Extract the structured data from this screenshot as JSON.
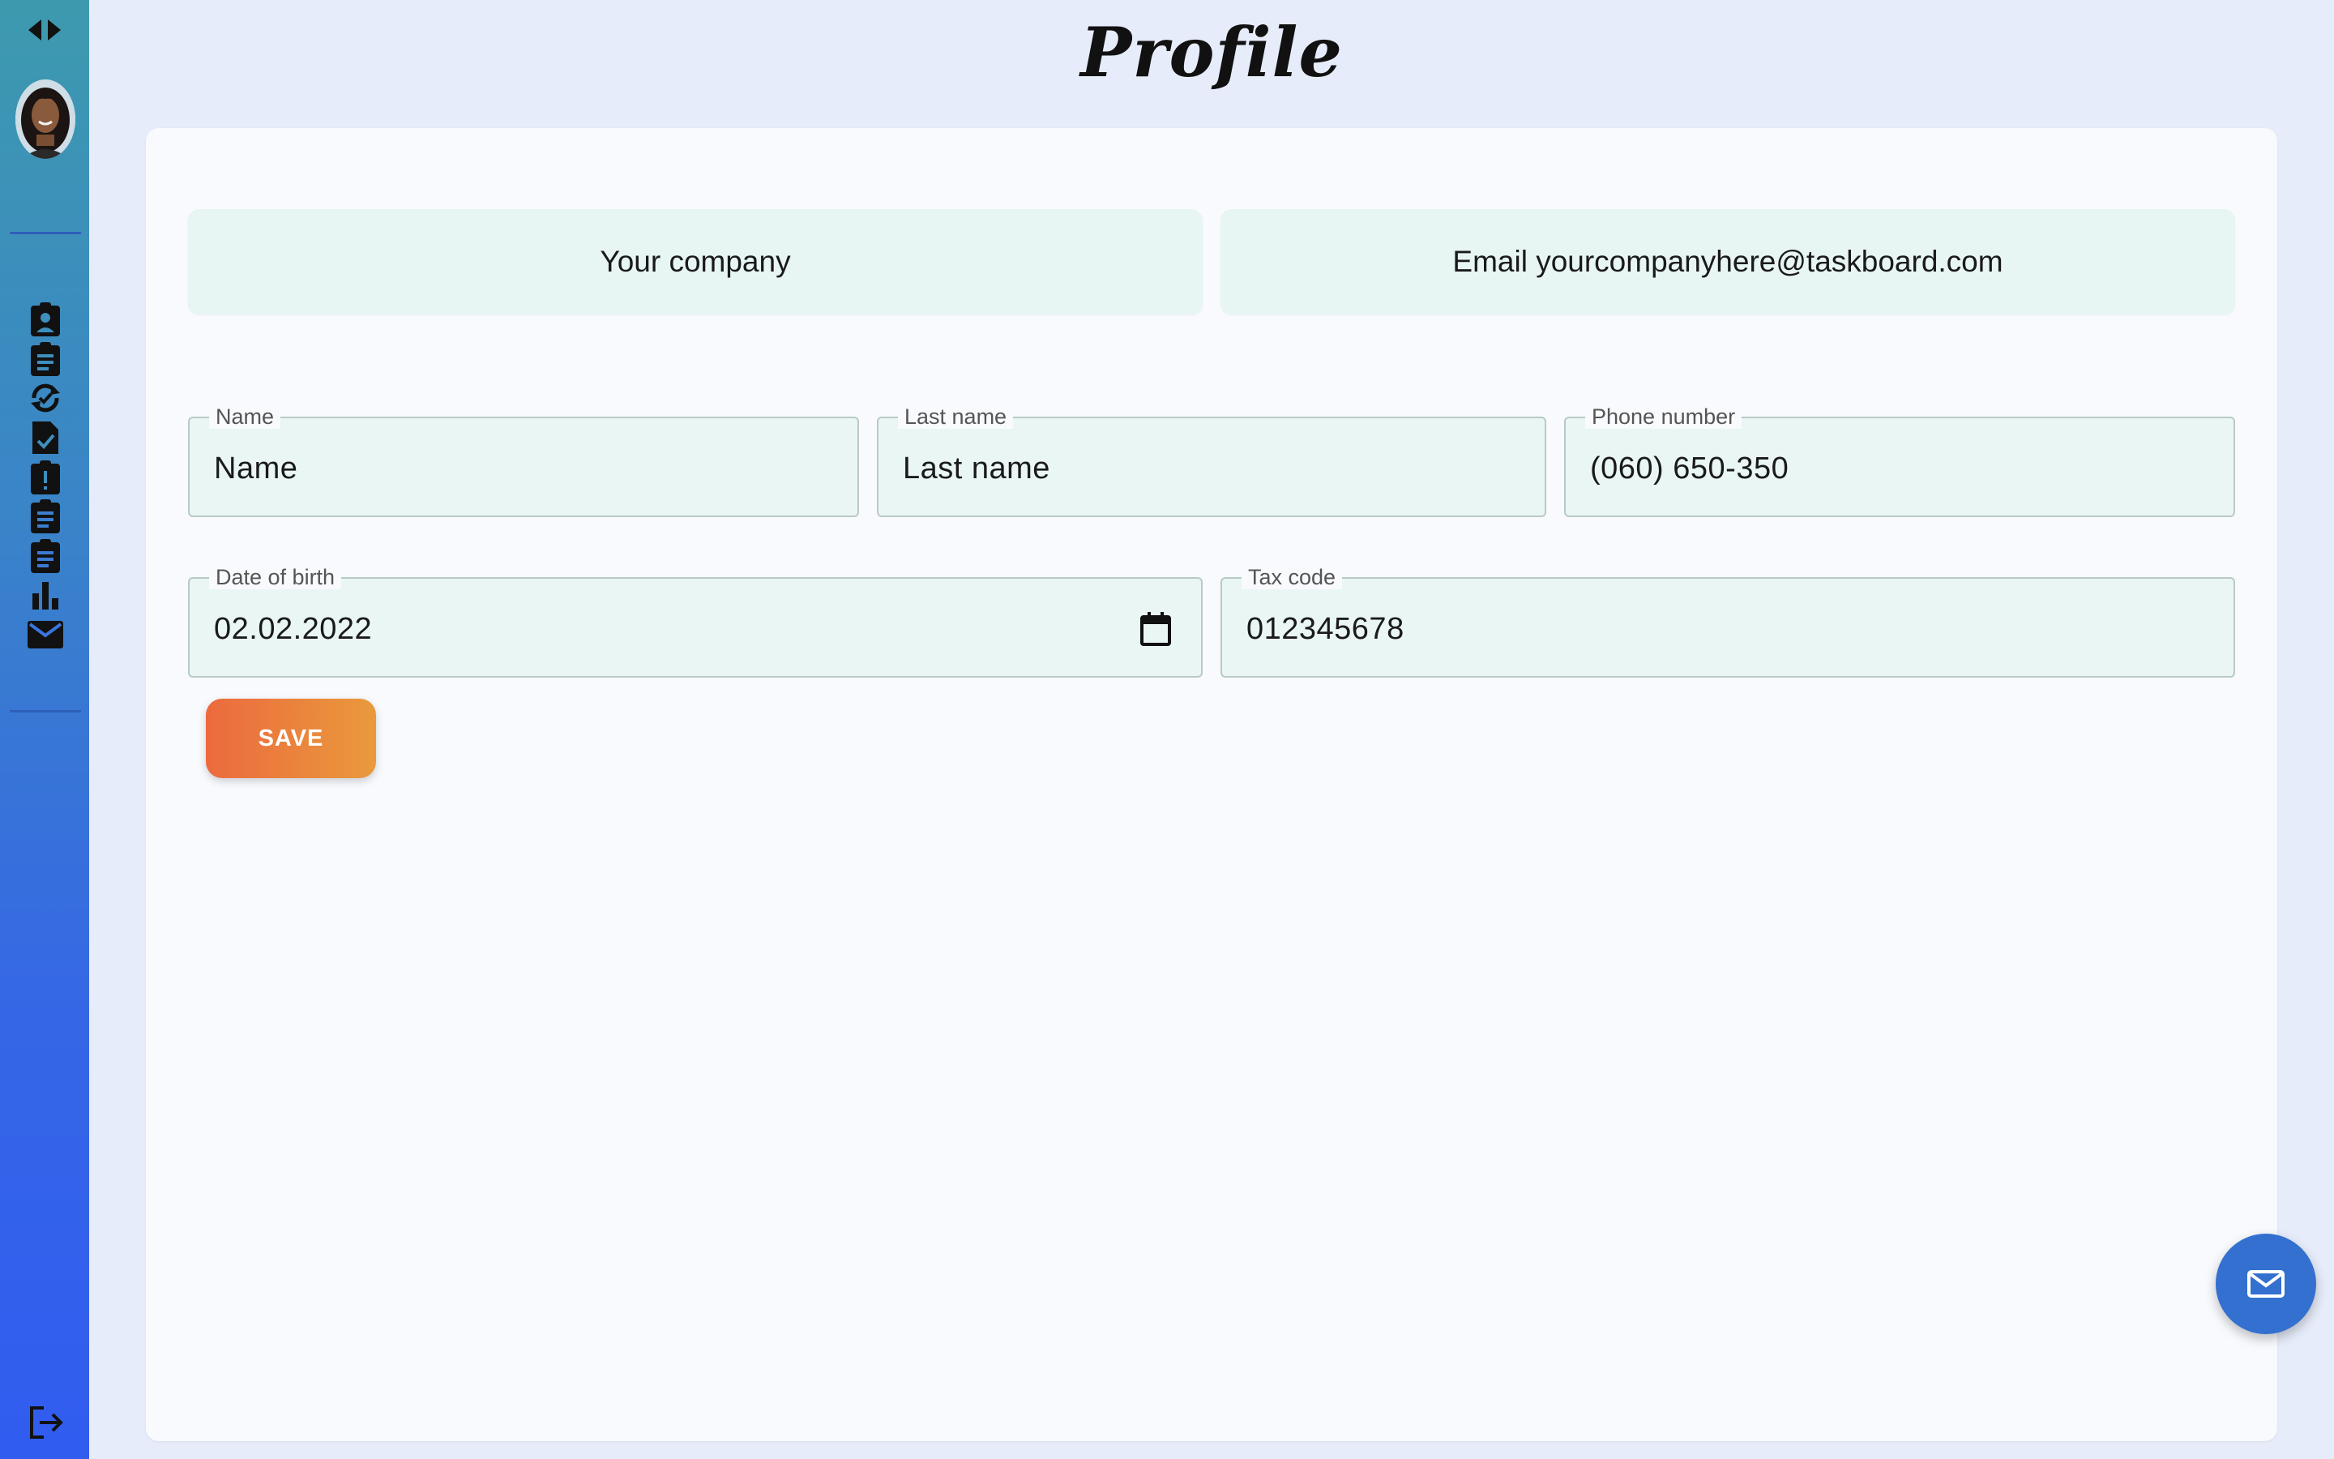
{
  "page": {
    "title": "Profile"
  },
  "sidebar": {
    "toggle_icon": "expand-collapse-icon",
    "avatar_alt": "user avatar",
    "items": [
      {
        "icon": "assignment-ind-icon"
      },
      {
        "icon": "assignment-icon"
      },
      {
        "icon": "sync-refresh-icon"
      },
      {
        "icon": "task-done-icon"
      },
      {
        "icon": "assignment-late-icon"
      },
      {
        "icon": "assignment-list-icon"
      },
      {
        "icon": "assignment-list-icon"
      },
      {
        "icon": "bar-chart-icon"
      },
      {
        "icon": "mail-icon"
      }
    ],
    "logout_icon": "logout-icon"
  },
  "profile": {
    "company": "Your company",
    "email": "Email yourcompanyhere@taskboard.com"
  },
  "form": {
    "name": {
      "label": "Name",
      "value": "Name"
    },
    "last_name": {
      "label": "Last name",
      "value": "Last name"
    },
    "phone": {
      "label": "Phone number",
      "value": "(060) 650-350"
    },
    "dob": {
      "label": "Date of birth",
      "value": "02.02.2022"
    },
    "tax_code": {
      "label": "Tax code",
      "value": "012345678"
    },
    "save_label": "SAVE"
  },
  "fab": {
    "icon": "mail-icon"
  },
  "colors": {
    "background": "#e6ecf9",
    "card": "#f8fafe",
    "field_bg": "#e9f6f4",
    "save_gradient_start": "#ec6a3e",
    "save_gradient_end": "#e99a3c",
    "fab": "#3370cf"
  }
}
